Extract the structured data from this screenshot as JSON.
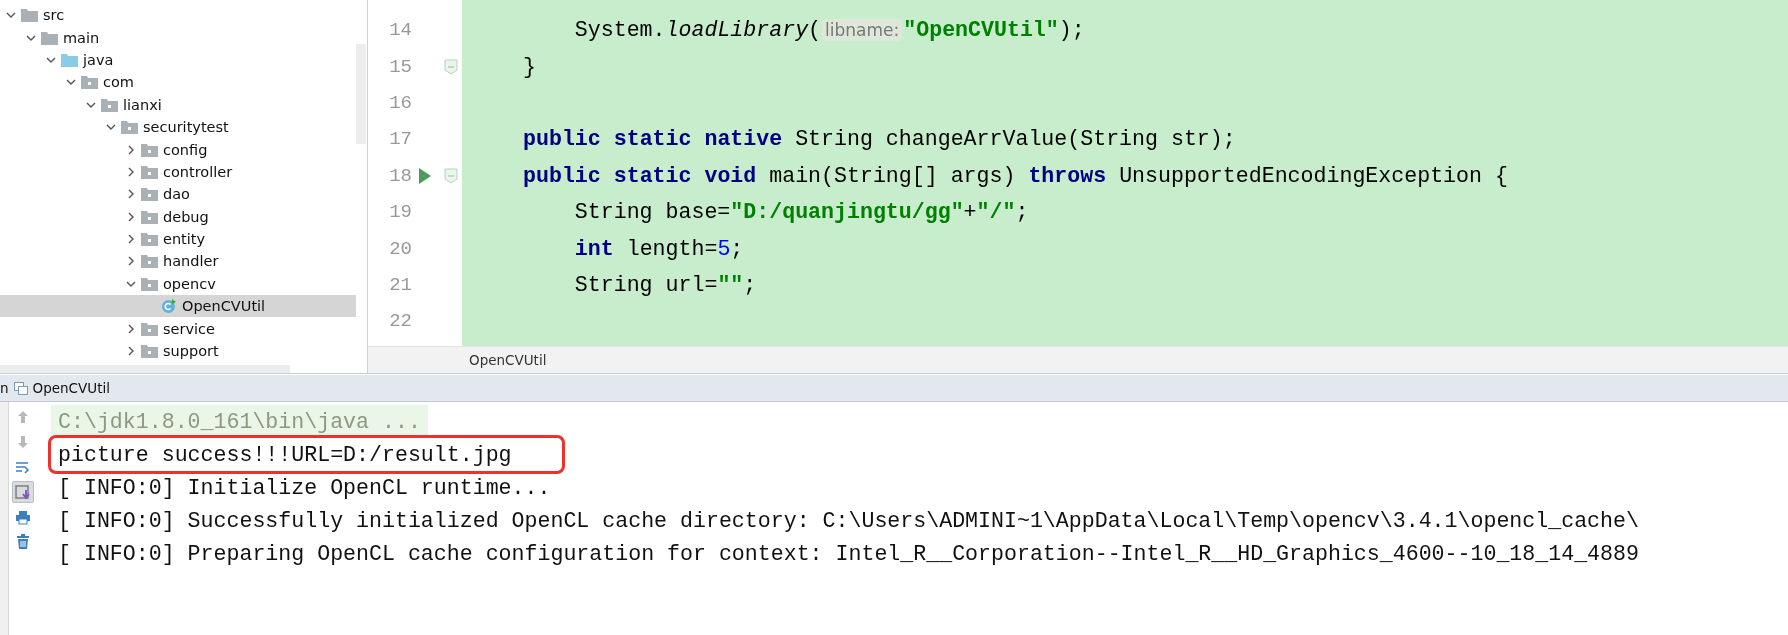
{
  "project_tree": [
    {
      "label": "src",
      "kind": "folder",
      "expanded": true,
      "selected": false,
      "children": [
        {
          "label": "main",
          "kind": "folder",
          "expanded": true,
          "selected": false,
          "children": [
            {
              "label": "java",
              "kind": "source",
              "expanded": true,
              "selected": false,
              "children": [
                {
                  "label": "com",
                  "kind": "package",
                  "expanded": true,
                  "selected": false,
                  "children": [
                    {
                      "label": "lianxi",
                      "kind": "package",
                      "expanded": true,
                      "selected": false,
                      "children": [
                        {
                          "label": "securitytest",
                          "kind": "package",
                          "expanded": true,
                          "selected": false,
                          "children": [
                            {
                              "label": "config",
                              "kind": "package",
                              "expanded": false,
                              "selected": false
                            },
                            {
                              "label": "controller",
                              "kind": "package",
                              "expanded": false,
                              "selected": false
                            },
                            {
                              "label": "dao",
                              "kind": "package",
                              "expanded": false,
                              "selected": false
                            },
                            {
                              "label": "debug",
                              "kind": "package",
                              "expanded": false,
                              "selected": false
                            },
                            {
                              "label": "entity",
                              "kind": "package",
                              "expanded": false,
                              "selected": false
                            },
                            {
                              "label": "handler",
                              "kind": "package",
                              "expanded": false,
                              "selected": false
                            },
                            {
                              "label": "opencv",
                              "kind": "package",
                              "expanded": true,
                              "selected": false,
                              "children": [
                                {
                                  "label": "OpenCVUtil",
                                  "kind": "class",
                                  "selected": true
                                }
                              ]
                            },
                            {
                              "label": "service",
                              "kind": "package",
                              "expanded": false,
                              "selected": false
                            },
                            {
                              "label": "support",
                              "kind": "package",
                              "expanded": false,
                              "selected": false
                            }
                          ]
                        }
                      ]
                    }
                  ]
                }
              ]
            }
          ]
        }
      ]
    }
  ],
  "editor": {
    "lines": [
      {
        "number": "14",
        "kind": "statement",
        "tokens": [
          {
            "kind": "plain",
            "text": "System."
          },
          {
            "kind": "method",
            "text": "loadLibrary"
          },
          {
            "kind": "plain",
            "text": "("
          },
          {
            "kind": "hint",
            "text": "libname:"
          },
          {
            "kind": "string",
            "text": "\"OpenCVUtil\""
          },
          {
            "kind": "plain",
            "text": ");"
          }
        ]
      },
      {
        "number": "15",
        "kind": "member",
        "fold": true,
        "tokens": [
          {
            "kind": "plain",
            "text": "}"
          }
        ]
      },
      {
        "number": "16"
      },
      {
        "number": "17",
        "kind": "member",
        "tokens": [
          {
            "kind": "keyword",
            "text": "public static native"
          },
          {
            "kind": "plain",
            "text": " String changeArrValue(String str);"
          }
        ]
      },
      {
        "number": "18",
        "kind": "member",
        "run": true,
        "fold": true,
        "tokens": [
          {
            "kind": "keyword",
            "text": "public static void"
          },
          {
            "kind": "plain",
            "text": " main(String[] args) "
          },
          {
            "kind": "keyword",
            "text": "throws"
          },
          {
            "kind": "plain",
            "text": " UnsupportedEncodingException {"
          }
        ]
      },
      {
        "number": "19",
        "kind": "statement",
        "tokens": [
          {
            "kind": "plain",
            "text": "String base="
          },
          {
            "kind": "string",
            "text": "\"D:/quanjingtu/gg\""
          },
          {
            "kind": "plain",
            "text": "+"
          },
          {
            "kind": "string",
            "text": "\"/\""
          },
          {
            "kind": "plain",
            "text": ";"
          }
        ]
      },
      {
        "number": "20",
        "kind": "statement",
        "tokens": [
          {
            "kind": "keyword",
            "text": "int"
          },
          {
            "kind": "plain",
            "text": " length="
          },
          {
            "kind": "number",
            "text": "5"
          },
          {
            "kind": "plain",
            "text": ";"
          }
        ]
      },
      {
        "number": "21",
        "kind": "statement",
        "tokens": [
          {
            "kind": "plain",
            "text": "String url="
          },
          {
            "kind": "string",
            "text": "\"\""
          },
          {
            "kind": "plain",
            "text": ";"
          }
        ]
      },
      {
        "number": "22"
      }
    ],
    "breadcrumb": "OpenCVUtil"
  },
  "run_panel": {
    "label": "n",
    "tab": "OpenCVUtil",
    "toolbar": [
      {
        "kind": "up",
        "selected": false
      },
      {
        "kind": "down",
        "selected": false
      },
      {
        "kind": "wrap",
        "selected": false
      },
      {
        "kind": "scroll",
        "selected": true
      },
      {
        "kind": "print",
        "selected": false
      },
      {
        "kind": "trash",
        "selected": false
      }
    ],
    "lines": [
      {
        "kind": "command",
        "highlighted": false,
        "text": "C:\\jdk1.8.0_161\\bin\\java ..."
      },
      {
        "kind": "output",
        "highlighted": true,
        "text": "picture success!!!URL=D:/result.jpg"
      },
      {
        "kind": "output",
        "highlighted": false,
        "text": "[ INFO:0] Initialize OpenCL runtime..."
      },
      {
        "kind": "output",
        "highlighted": false,
        "text": "[ INFO:0] Successfully initialized OpenCL cache directory: C:\\Users\\ADMINI~1\\AppData\\Local\\Temp\\opencv\\3.4.1\\opencl_cache\\"
      },
      {
        "kind": "output",
        "highlighted": false,
        "text": "[ INFO:0] Preparing OpenCL cache configuration for context: Intel_R__Corporation--Intel_R__HD_Graphics_4600--10_18_14_4889"
      }
    ]
  }
}
